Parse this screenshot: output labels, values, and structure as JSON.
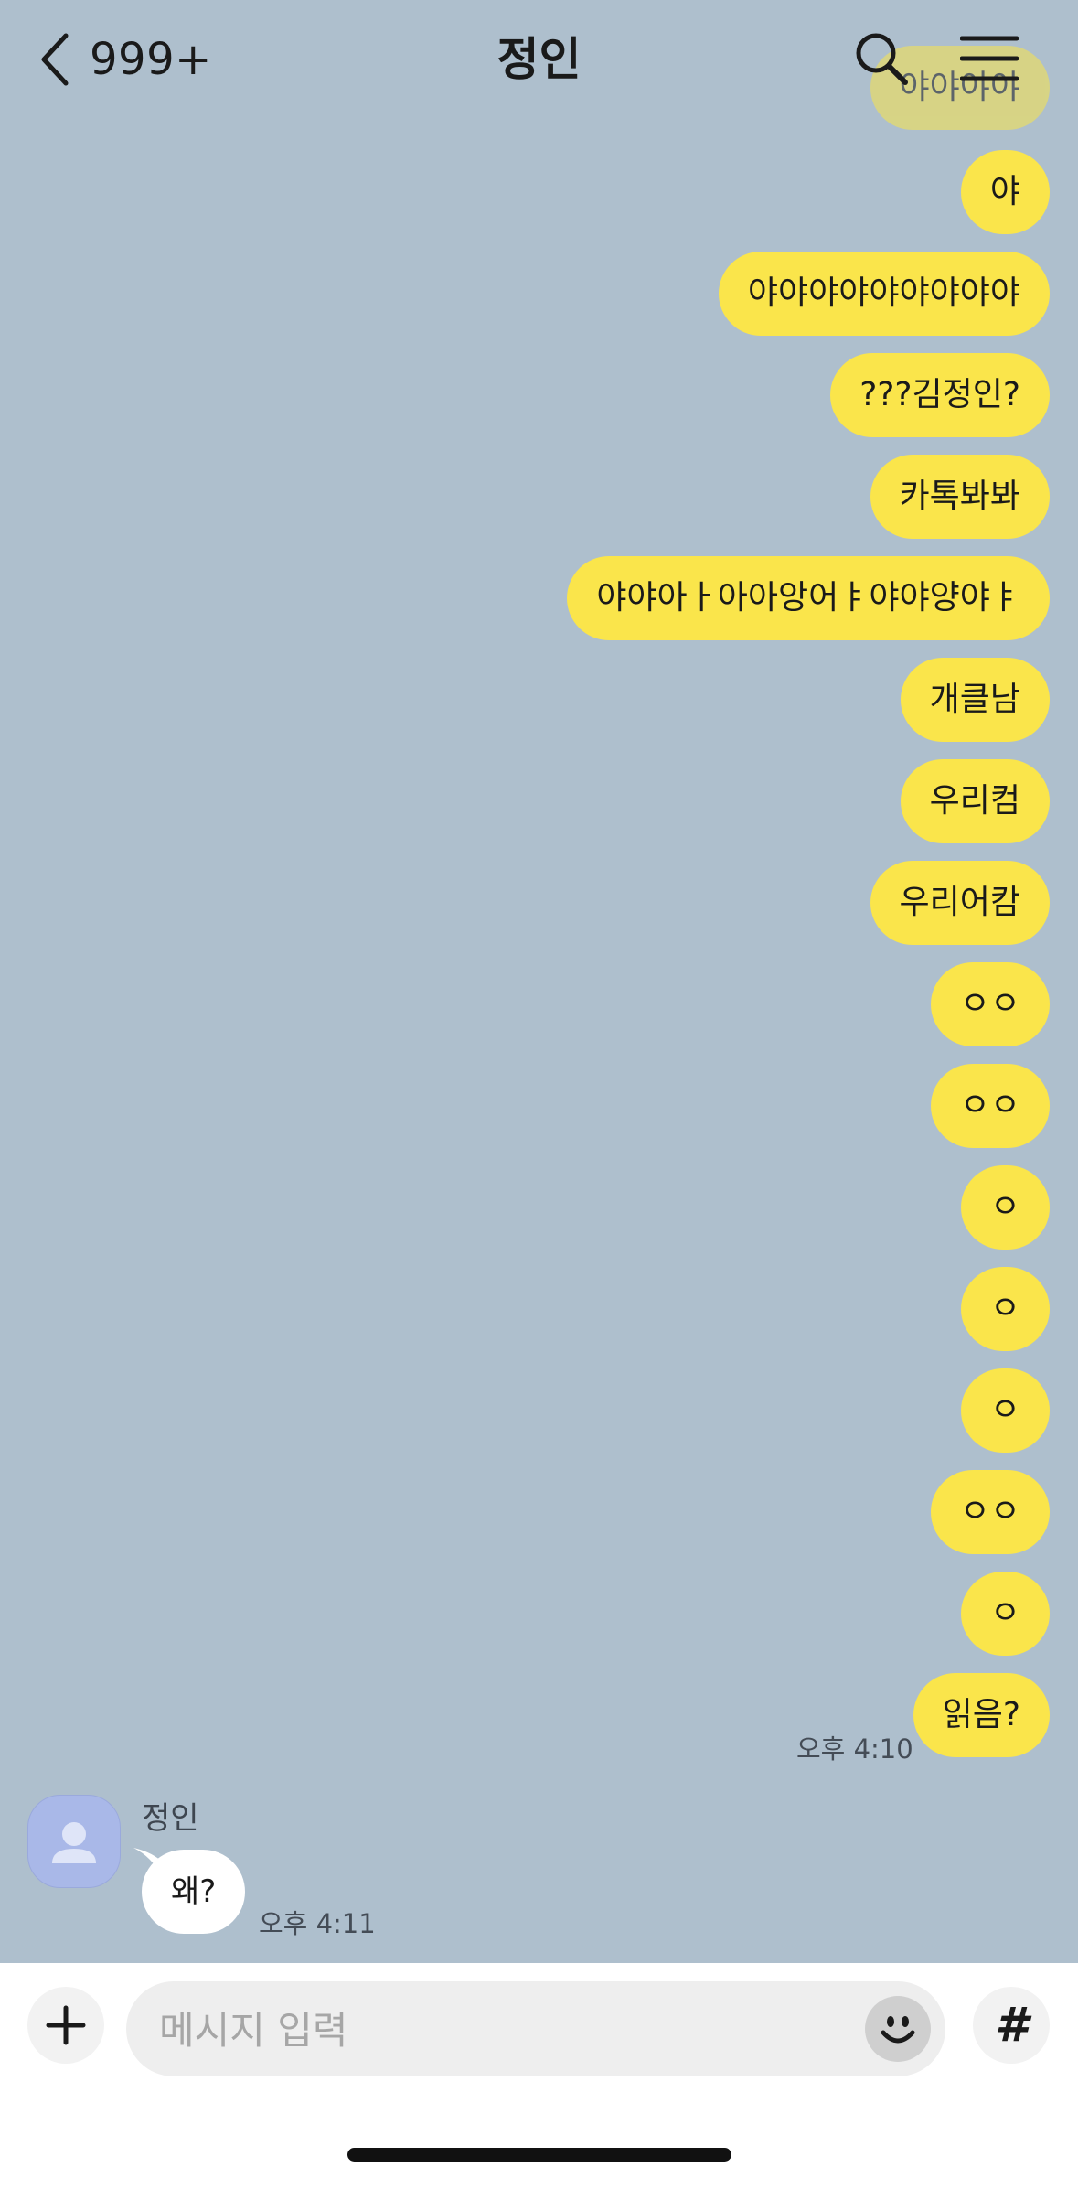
{
  "header": {
    "unread_count": "999+",
    "title": "정인",
    "icons": [
      "chevron-left-icon",
      "search-icon",
      "hamburger-menu-icon"
    ]
  },
  "conversation": {
    "outgoing_messages": [
      "야야야야",
      "야",
      "야야야야야야야야야",
      "???김정인?",
      "카톡봐봐",
      "야야아ㅏ아아앙어ㅑ야야양야ㅑ",
      "개클남",
      "우리컴",
      "우리어캄",
      "ㅇㅇ",
      "ㅇㅇ",
      "ㅇ",
      "ㅇ",
      "ㅇ",
      "ㅇㅇ",
      "ㅇ",
      "읽음?"
    ],
    "outgoing_time": "오후 4:10",
    "incoming": {
      "sender": "정인",
      "message": "왜?",
      "time": "오후 4:11"
    }
  },
  "composer": {
    "placeholder": "메시지 입력",
    "hash_label": "#"
  },
  "colors": {
    "background": "#aebfcd",
    "outgoing_bubble": "#fae54b",
    "incoming_bubble": "#ffffff",
    "avatar": "#a9b8e8"
  }
}
